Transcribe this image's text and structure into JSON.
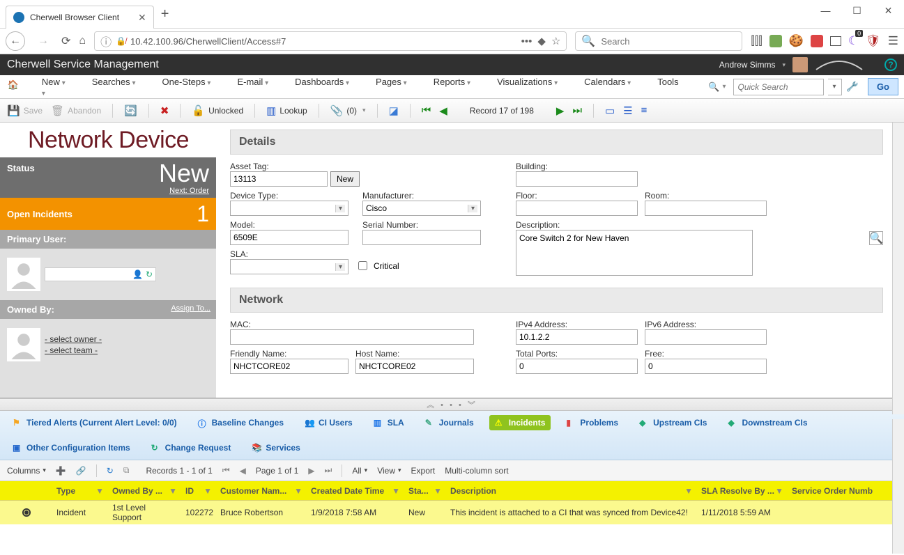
{
  "browser": {
    "tab_title": "Cherwell Browser Client",
    "url": "10.42.100.96/CherwellClient/Access#7",
    "search_placeholder": "Search"
  },
  "app": {
    "title": "Cherwell Service Management",
    "user_name": "Andrew Simms"
  },
  "menu": {
    "items": [
      "New",
      "Searches",
      "One-Steps",
      "E-mail",
      "Dashboards",
      "Pages",
      "Reports",
      "Visualizations",
      "Calendars",
      "Tools"
    ],
    "quick_search_placeholder": "Quick Search",
    "go": "Go"
  },
  "actions": {
    "save": "Save",
    "abandon": "Abandon",
    "unlocked": "Unlocked",
    "lookup": "Lookup",
    "attach_count": "(0)",
    "record_pos": "Record 17 of 198"
  },
  "record": {
    "type_title": "Network Device",
    "status_label": "Status",
    "status_value": "New",
    "status_next": "Next: Order",
    "open_incidents_label": "Open Incidents",
    "open_incidents_count": "1",
    "primary_user_label": "Primary User:",
    "owned_by_label": "Owned By:",
    "assign_to": "Assign To...",
    "select_owner": "- select owner -",
    "select_team": "- select team -"
  },
  "details": {
    "header": "Details",
    "asset_tag_label": "Asset Tag:",
    "asset_tag": "13113",
    "new_btn": "New",
    "device_type_label": "Device Type:",
    "device_type": "",
    "manufacturer_label": "Manufacturer:",
    "manufacturer": "Cisco",
    "model_label": "Model:",
    "model": "6509E",
    "serial_label": "Serial Number:",
    "serial": "",
    "sla_label": "SLA:",
    "sla": "",
    "critical_label": "Critical",
    "building_label": "Building:",
    "building": "",
    "floor_label": "Floor:",
    "floor": "",
    "room_label": "Room:",
    "room": "",
    "description_label": "Description:",
    "description": "Core Switch 2 for New Haven"
  },
  "network": {
    "header": "Network",
    "mac_label": "MAC:",
    "mac": "",
    "friendly_label": "Friendly Name:",
    "friendly": "NHCTCORE02",
    "host_label": "Host Name:",
    "host": "NHCTCORE02",
    "ipv4_label": "IPv4 Address:",
    "ipv4": "10.1.2.2",
    "ipv6_label": "IPv6 Address:",
    "ipv6": "",
    "ports_label": "Total Ports:",
    "ports": "0",
    "free_label": "Free:",
    "free": "0"
  },
  "tabs": {
    "tiered": "Tiered Alerts (Current Alert Level: 0/0)",
    "baseline": "Baseline Changes",
    "ciusers": "CI Users",
    "sla": "SLA",
    "journals": "Journals",
    "incidents": "Incidents",
    "problems": "Problems",
    "upstream": "Upstream CIs",
    "downstream": "Downstream CIs",
    "other": "Other Configuration Items",
    "change": "Change Request",
    "services": "Services"
  },
  "grid_tb": {
    "columns": "Columns",
    "records": "Records  1 - 1  of  1",
    "page": "Page  1  of  1",
    "all": "All",
    "view": "View",
    "export": "Export",
    "multicol": "Multi-column sort"
  },
  "grid": {
    "headers": {
      "type": "Type",
      "owned": "Owned By ...",
      "id": "ID",
      "cust": "Customer Nam...",
      "created": "Created Date Time",
      "status": "Sta...",
      "desc": "Description",
      "sla": "SLA Resolve By ...",
      "order": "Service Order Numb"
    },
    "row": {
      "type": "Incident",
      "owned": "1st Level Support",
      "id": "102272",
      "cust": "Bruce Robertson",
      "created": "1/9/2018 7:58 AM",
      "status": "New",
      "desc": "This incident is attached to a CI that was synced from Device42!",
      "sla": "1/11/2018 5:59 AM",
      "order": ""
    }
  }
}
